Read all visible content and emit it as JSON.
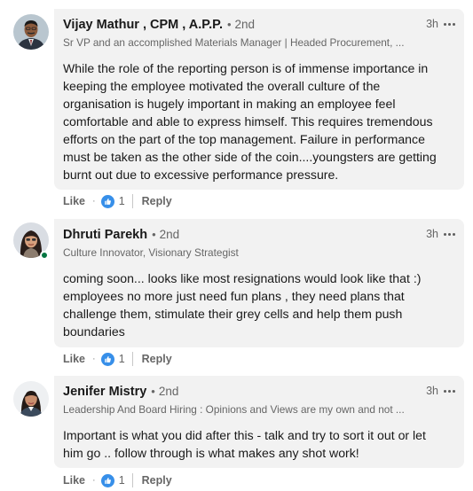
{
  "comments": [
    {
      "author": "Vijay Mathur , CPM , A.P.P.",
      "degree": "2nd",
      "headline": "Sr VP and an accomplished Materials Manager | Headed Procurement, ...",
      "time": "3h",
      "body": [
        "While the role of the reporting person is of immense importance in",
        "keeping the employee motivated the overall culture of the",
        "organisation is hugely important in making an employee feel",
        "comfortable and able to express himself. This requires tremendous",
        "efforts on the part of the top management. Failure in performance",
        "must be taken as the other side of the coin....youngsters are getting",
        "burnt out due to excessive performance pressure."
      ],
      "like_label": "Like",
      "reaction_count": "1",
      "reply_label": "Reply"
    },
    {
      "author": "Dhruti Parekh",
      "degree": "2nd",
      "headline": "Culture Innovator, Visionary Strategist",
      "time": "3h",
      "body": [
        "coming soon... looks like most resignations would look like that :)",
        "employees no more just need fun plans , they need plans that",
        "challenge them, stimulate their grey cells and help them push",
        "boundaries"
      ],
      "like_label": "Like",
      "reaction_count": "1",
      "reply_label": "Reply"
    },
    {
      "author": "Jenifer Mistry",
      "degree": "2nd",
      "headline": "Leadership And Board Hiring : Opinions and Views are my own and not ...",
      "time": "3h",
      "body": [
        "Important is what you did after this - talk and try to sort it out or let",
        "him go .. follow through is what makes any shot work!"
      ],
      "like_label": "Like",
      "reaction_count": "1",
      "reply_label": "Reply"
    }
  ],
  "icons": {
    "reaction": "like-thumbs-up-icon",
    "more": "more-horizontal-icon"
  },
  "colors": {
    "bubble_bg": "#f2f2f2",
    "muted_text": "#666666",
    "like_blue": "#378fe9",
    "online_green": "#057642"
  }
}
